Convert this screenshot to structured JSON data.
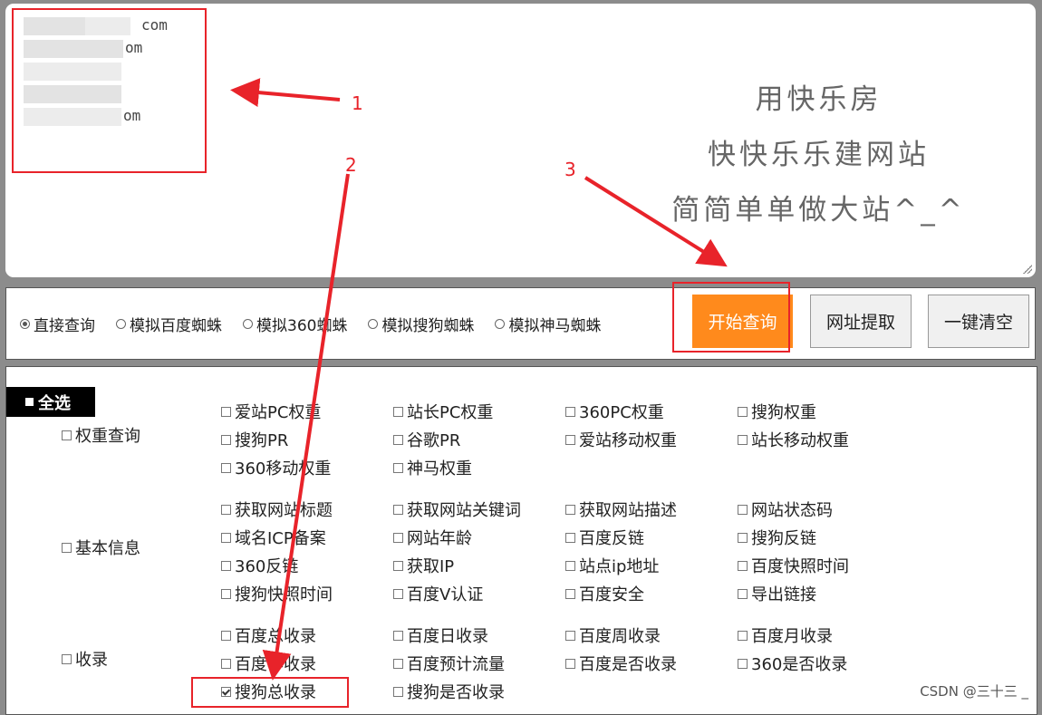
{
  "url_input": {
    "lines": [
      {
        "suffix": "com"
      },
      {
        "suffix": "om"
      },
      {
        "suffix": ""
      },
      {
        "suffix": ""
      },
      {
        "suffix": "om"
      }
    ]
  },
  "slogan": [
    "用快乐房",
    "快快乐乐建网站",
    "简简单单做大站^_^"
  ],
  "modes": [
    {
      "label": "直接查询",
      "selected": true
    },
    {
      "label": "模拟百度蜘蛛",
      "selected": false
    },
    {
      "label": "模拟360蜘蛛",
      "selected": false
    },
    {
      "label": "模拟搜狗蜘蛛",
      "selected": false
    },
    {
      "label": "模拟神马蜘蛛",
      "selected": false
    }
  ],
  "buttons": {
    "start": "开始查询",
    "extract": "网址提取",
    "clear": "一键清空"
  },
  "select_all": "全选",
  "groups": [
    {
      "label": "权重查询",
      "items": [
        {
          "label": "爱站PC权重",
          "checked": false
        },
        {
          "label": "站长PC权重",
          "checked": false
        },
        {
          "label": "360PC权重",
          "checked": false
        },
        {
          "label": "搜狗权重",
          "checked": false
        },
        {
          "label": "搜狗PR",
          "checked": false
        },
        {
          "label": "谷歌PR",
          "checked": false
        },
        {
          "label": "爱站移动权重",
          "checked": false
        },
        {
          "label": "站长移动权重",
          "checked": false
        },
        {
          "label": "360移动权重",
          "checked": false
        },
        {
          "label": "神马权重",
          "checked": false
        }
      ]
    },
    {
      "label": "基本信息",
      "items": [
        {
          "label": "获取网站标题",
          "checked": false
        },
        {
          "label": "获取网站关键词",
          "checked": false
        },
        {
          "label": "获取网站描述",
          "checked": false
        },
        {
          "label": "网站状态码",
          "checked": false
        },
        {
          "label": "域名ICP备案",
          "checked": false
        },
        {
          "label": "网站年龄",
          "checked": false
        },
        {
          "label": "百度反链",
          "checked": false
        },
        {
          "label": "搜狗反链",
          "checked": false
        },
        {
          "label": "360反链",
          "checked": false
        },
        {
          "label": "获取IP",
          "checked": false
        },
        {
          "label": "站点ip地址",
          "checked": false
        },
        {
          "label": "百度快照时间",
          "checked": false
        },
        {
          "label": "搜狗快照时间",
          "checked": false
        },
        {
          "label": "百度V认证",
          "checked": false
        },
        {
          "label": "百度安全",
          "checked": false
        },
        {
          "label": "导出链接",
          "checked": false
        }
      ]
    },
    {
      "label": "收录",
      "items": [
        {
          "label": "百度总收录",
          "checked": false
        },
        {
          "label": "百度日收录",
          "checked": false
        },
        {
          "label": "百度周收录",
          "checked": false
        },
        {
          "label": "百度月收录",
          "checked": false
        },
        {
          "label": "百度年收录",
          "checked": false
        },
        {
          "label": "百度预计流量",
          "checked": false
        },
        {
          "label": "百度是否收录",
          "checked": false
        },
        {
          "label": "360是否收录",
          "checked": false
        },
        {
          "label": "搜狗总收录",
          "checked": true
        },
        {
          "label": "搜狗是否收录",
          "checked": false
        }
      ]
    }
  ],
  "annotations": {
    "n1": "1",
    "n2": "2",
    "n3": "3",
    "color": "#e8232a"
  },
  "watermark": "CSDN @三十三 _"
}
